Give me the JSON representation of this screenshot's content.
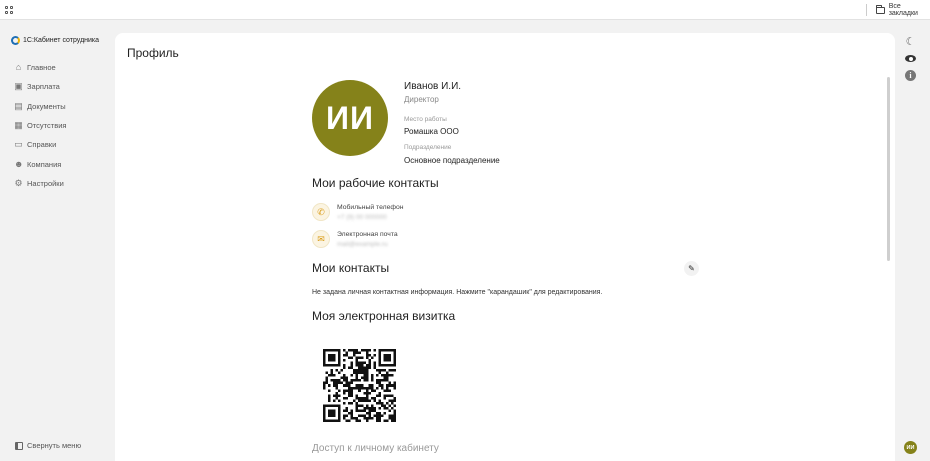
{
  "browser": {
    "bookmarks_folder_label": "Все закладки"
  },
  "sidebar": {
    "app_name": "1С:Кабинет сотрудника",
    "items": [
      {
        "label": "Главное",
        "icon": "home-icon"
      },
      {
        "label": "Зарплата",
        "icon": "wallet-icon"
      },
      {
        "label": "Документы",
        "icon": "documents-icon"
      },
      {
        "label": "Отсутствия",
        "icon": "calendar-icon"
      },
      {
        "label": "Справки",
        "icon": "certificates-icon"
      },
      {
        "label": "Компания",
        "icon": "people-icon"
      },
      {
        "label": "Настройки",
        "icon": "gear-icon"
      }
    ],
    "collapse_label": "Свернуть меню"
  },
  "profile": {
    "page_title": "Профиль",
    "avatar_initials": "ИИ",
    "avatar_color": "#85821a",
    "name": "Иванов И.И.",
    "position": "Директор",
    "workplace_caption": "Место работы",
    "workplace_value": "Ромашка ООО",
    "department_caption": "Подразделение",
    "department_value": "Основное подразделение"
  },
  "work_contacts": {
    "heading": "Мои рабочие контакты",
    "items": [
      {
        "caption": "Мобильный телефон",
        "value": "+7 (9) 00 000000",
        "icon": "phone-icon"
      },
      {
        "caption": "Электронная почта",
        "value": "mail@example.ru",
        "icon": "mail-icon"
      }
    ]
  },
  "my_contacts": {
    "heading": "Мои контакты",
    "edit_icon": "pencil-icon",
    "note": "Не задана личная контактная информация. Нажмите \"карандашик\" для редактирования."
  },
  "vcard": {
    "heading": "Моя электронная визитка"
  },
  "access": {
    "heading": "Доступ к личному кабинету"
  },
  "rail": {
    "icons": [
      "moon-icon",
      "eye-icon",
      "info-icon"
    ],
    "user_initials": "ИИ"
  }
}
